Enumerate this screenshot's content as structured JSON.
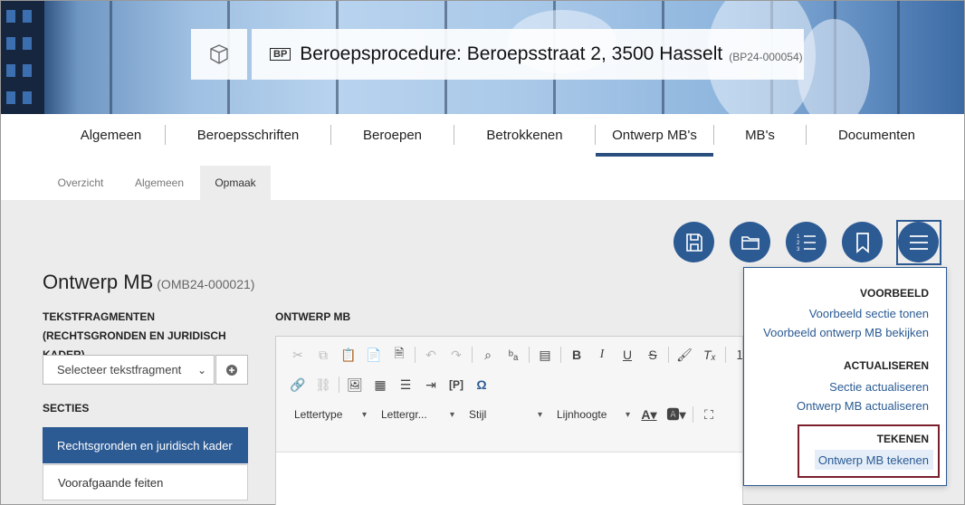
{
  "header": {
    "badge": "BP",
    "title": "Beroepsprocedure: Beroepsstraat 2, 3500 Hasselt",
    "ref": "(BP24-000054)"
  },
  "nav": {
    "tabs": [
      "Algemeen",
      "Beroepsschriften",
      "Beroepen",
      "Betrokkenen",
      "Ontwerp MB's",
      "MB's",
      "Documenten"
    ],
    "active": "Ontwerp MB's"
  },
  "subnav": {
    "tabs": [
      "Overzicht",
      "Algemeen",
      "Opmaak"
    ],
    "active": "Opmaak"
  },
  "toolbar_icons": [
    "save-icon",
    "folder-icon",
    "numbered-list-icon",
    "bookmark-icon",
    "hamburger-menu-icon"
  ],
  "page": {
    "title": "Ontwerp MB",
    "ref": "(OMB24-000021)"
  },
  "left": {
    "fragments_label": "TEKSTFRAGMENTEN (RECHTSGRONDEN EN JURIDISCH KADER)",
    "select_placeholder": "Selecteer tekstfragment",
    "sections_label": "SECTIES",
    "sections": [
      "Rechtsgronden en juridisch kader",
      "Voorafgaande feiten"
    ]
  },
  "editor": {
    "label": "ONTWERP MB",
    "combos": [
      "Lettertype",
      "Lettergr...",
      "Stijl",
      "Lijnhoogte"
    ]
  },
  "menu": {
    "voorbeeld": {
      "title": "VOORBEELD",
      "items": [
        "Voorbeeld sectie tonen",
        "Voorbeeld ontwerp MB bekijken"
      ]
    },
    "actualiseren": {
      "title": "ACTUALISEREN",
      "items": [
        "Sectie actualiseren",
        "Ontwerp MB actualiseren"
      ]
    },
    "tekenen": {
      "title": "TEKENEN",
      "items": [
        "Ontwerp MB tekenen"
      ]
    }
  },
  "colors": {
    "primary": "#2c5a93",
    "highlight_border": "#7a1f2b"
  }
}
